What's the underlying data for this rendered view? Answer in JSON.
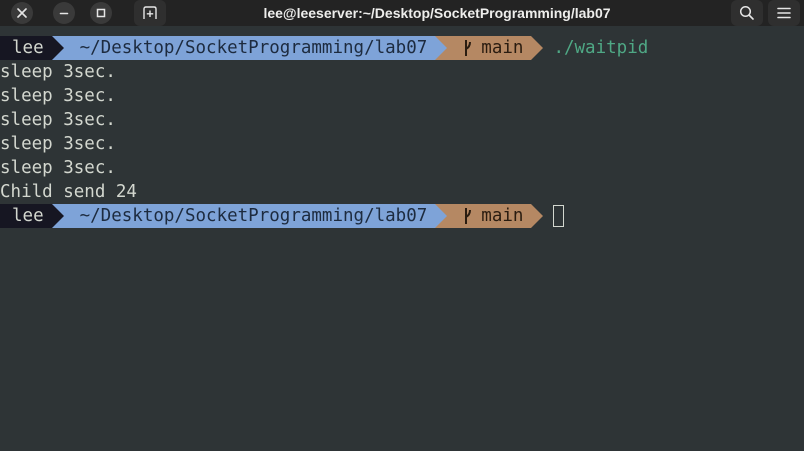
{
  "window": {
    "title": "lee@leeserver:~/Desktop/SocketProgramming/lab07",
    "buttons": {
      "close_icon": "close-icon",
      "minimize_icon": "minimize-icon",
      "maximize_icon": "maximize-icon",
      "new_tab_icon": "new-tab-icon",
      "search_icon": "search-icon",
      "menu_icon": "hamburger-menu-icon"
    }
  },
  "terminal": {
    "prompt1": {
      "user": "lee",
      "path": "~/Desktop/SocketProgramming/lab07",
      "branch": "main",
      "command": "./waitpid"
    },
    "output": [
      "sleep 3sec.",
      "sleep 3sec.",
      "sleep 3sec.",
      "sleep 3sec.",
      "sleep 3sec.",
      "Child send 24"
    ],
    "prompt2": {
      "user": "lee",
      "path": "~/Desktop/SocketProgramming/lab07",
      "branch": "main"
    }
  },
  "colors": {
    "background": "#2e3436",
    "text": "#d3d7cf",
    "user_segment": "#161622",
    "path_segment": "#7ea3d8",
    "git_segment": "#b58863",
    "command": "#4fa885"
  }
}
